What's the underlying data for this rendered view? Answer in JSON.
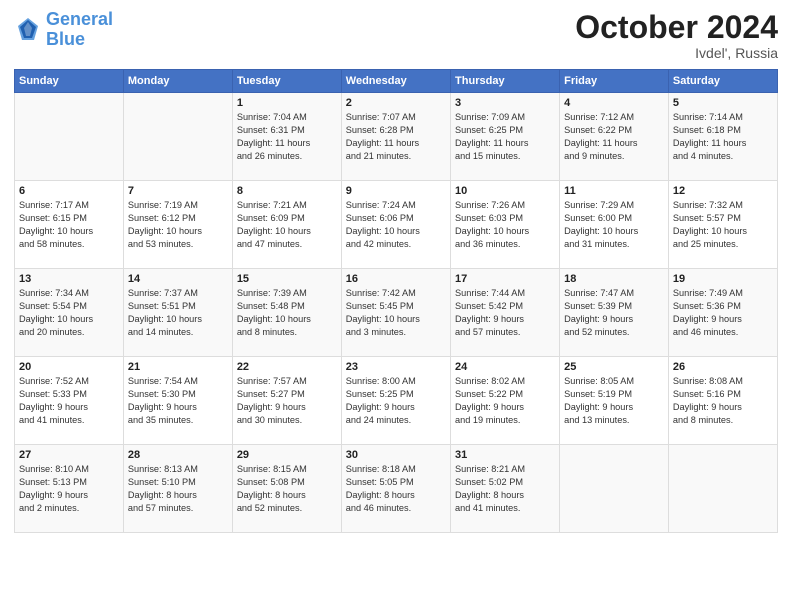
{
  "logo": {
    "text_general": "General",
    "text_blue": "Blue"
  },
  "header": {
    "title": "October 2024",
    "subtitle": "Ivdel', Russia"
  },
  "days_of_week": [
    "Sunday",
    "Monday",
    "Tuesday",
    "Wednesday",
    "Thursday",
    "Friday",
    "Saturday"
  ],
  "weeks": [
    {
      "cells": [
        {
          "day": "",
          "info": ""
        },
        {
          "day": "",
          "info": ""
        },
        {
          "day": "1",
          "info": "Sunrise: 7:04 AM\nSunset: 6:31 PM\nDaylight: 11 hours\nand 26 minutes."
        },
        {
          "day": "2",
          "info": "Sunrise: 7:07 AM\nSunset: 6:28 PM\nDaylight: 11 hours\nand 21 minutes."
        },
        {
          "day": "3",
          "info": "Sunrise: 7:09 AM\nSunset: 6:25 PM\nDaylight: 11 hours\nand 15 minutes."
        },
        {
          "day": "4",
          "info": "Sunrise: 7:12 AM\nSunset: 6:22 PM\nDaylight: 11 hours\nand 9 minutes."
        },
        {
          "day": "5",
          "info": "Sunrise: 7:14 AM\nSunset: 6:18 PM\nDaylight: 11 hours\nand 4 minutes."
        }
      ]
    },
    {
      "cells": [
        {
          "day": "6",
          "info": "Sunrise: 7:17 AM\nSunset: 6:15 PM\nDaylight: 10 hours\nand 58 minutes."
        },
        {
          "day": "7",
          "info": "Sunrise: 7:19 AM\nSunset: 6:12 PM\nDaylight: 10 hours\nand 53 minutes."
        },
        {
          "day": "8",
          "info": "Sunrise: 7:21 AM\nSunset: 6:09 PM\nDaylight: 10 hours\nand 47 minutes."
        },
        {
          "day": "9",
          "info": "Sunrise: 7:24 AM\nSunset: 6:06 PM\nDaylight: 10 hours\nand 42 minutes."
        },
        {
          "day": "10",
          "info": "Sunrise: 7:26 AM\nSunset: 6:03 PM\nDaylight: 10 hours\nand 36 minutes."
        },
        {
          "day": "11",
          "info": "Sunrise: 7:29 AM\nSunset: 6:00 PM\nDaylight: 10 hours\nand 31 minutes."
        },
        {
          "day": "12",
          "info": "Sunrise: 7:32 AM\nSunset: 5:57 PM\nDaylight: 10 hours\nand 25 minutes."
        }
      ]
    },
    {
      "cells": [
        {
          "day": "13",
          "info": "Sunrise: 7:34 AM\nSunset: 5:54 PM\nDaylight: 10 hours\nand 20 minutes."
        },
        {
          "day": "14",
          "info": "Sunrise: 7:37 AM\nSunset: 5:51 PM\nDaylight: 10 hours\nand 14 minutes."
        },
        {
          "day": "15",
          "info": "Sunrise: 7:39 AM\nSunset: 5:48 PM\nDaylight: 10 hours\nand 8 minutes."
        },
        {
          "day": "16",
          "info": "Sunrise: 7:42 AM\nSunset: 5:45 PM\nDaylight: 10 hours\nand 3 minutes."
        },
        {
          "day": "17",
          "info": "Sunrise: 7:44 AM\nSunset: 5:42 PM\nDaylight: 9 hours\nand 57 minutes."
        },
        {
          "day": "18",
          "info": "Sunrise: 7:47 AM\nSunset: 5:39 PM\nDaylight: 9 hours\nand 52 minutes."
        },
        {
          "day": "19",
          "info": "Sunrise: 7:49 AM\nSunset: 5:36 PM\nDaylight: 9 hours\nand 46 minutes."
        }
      ]
    },
    {
      "cells": [
        {
          "day": "20",
          "info": "Sunrise: 7:52 AM\nSunset: 5:33 PM\nDaylight: 9 hours\nand 41 minutes."
        },
        {
          "day": "21",
          "info": "Sunrise: 7:54 AM\nSunset: 5:30 PM\nDaylight: 9 hours\nand 35 minutes."
        },
        {
          "day": "22",
          "info": "Sunrise: 7:57 AM\nSunset: 5:27 PM\nDaylight: 9 hours\nand 30 minutes."
        },
        {
          "day": "23",
          "info": "Sunrise: 8:00 AM\nSunset: 5:25 PM\nDaylight: 9 hours\nand 24 minutes."
        },
        {
          "day": "24",
          "info": "Sunrise: 8:02 AM\nSunset: 5:22 PM\nDaylight: 9 hours\nand 19 minutes."
        },
        {
          "day": "25",
          "info": "Sunrise: 8:05 AM\nSunset: 5:19 PM\nDaylight: 9 hours\nand 13 minutes."
        },
        {
          "day": "26",
          "info": "Sunrise: 8:08 AM\nSunset: 5:16 PM\nDaylight: 9 hours\nand 8 minutes."
        }
      ]
    },
    {
      "cells": [
        {
          "day": "27",
          "info": "Sunrise: 8:10 AM\nSunset: 5:13 PM\nDaylight: 9 hours\nand 2 minutes."
        },
        {
          "day": "28",
          "info": "Sunrise: 8:13 AM\nSunset: 5:10 PM\nDaylight: 8 hours\nand 57 minutes."
        },
        {
          "day": "29",
          "info": "Sunrise: 8:15 AM\nSunset: 5:08 PM\nDaylight: 8 hours\nand 52 minutes."
        },
        {
          "day": "30",
          "info": "Sunrise: 8:18 AM\nSunset: 5:05 PM\nDaylight: 8 hours\nand 46 minutes."
        },
        {
          "day": "31",
          "info": "Sunrise: 8:21 AM\nSunset: 5:02 PM\nDaylight: 8 hours\nand 41 minutes."
        },
        {
          "day": "",
          "info": ""
        },
        {
          "day": "",
          "info": ""
        }
      ]
    }
  ]
}
